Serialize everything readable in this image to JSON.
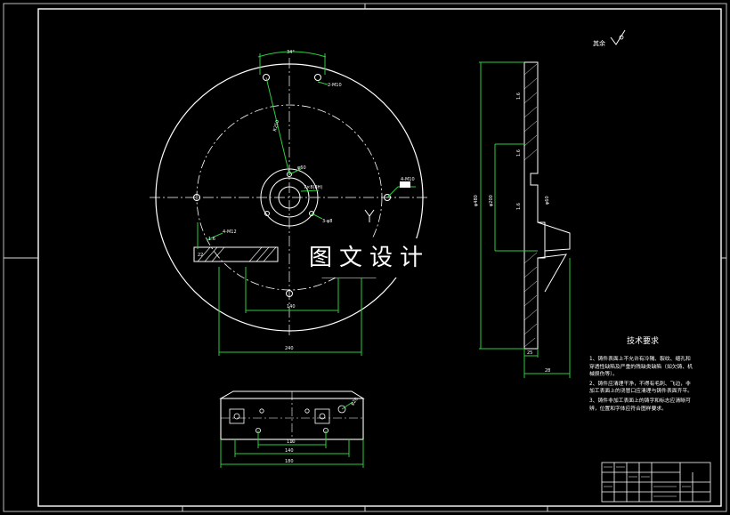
{
  "drawing": {
    "roughness_note": "其余",
    "watermark": "图文设计",
    "tech_requirements": {
      "title": "技术要求",
      "items": [
        "1、铸件表面上不允许有冷隔、裂纹、缩孔和穿透性缺陷及严重的残缺类缺陷（如欠铸、机械损伤等）。",
        "2、铸件应清理干净，不得有毛刺、飞边，非加工表面上的浇冒口应清理与铸件表面齐平。",
        "3、铸件非加工表面上的铸字和标志应清晰可辨，位置和字体应符合图样要求。"
      ]
    },
    "dims_front": {
      "angle": "34°",
      "holes_top": "2-M10",
      "radius": "R250",
      "center_dia": "φ60",
      "hub_label": "7×8(8H)",
      "side_holes": "4-M10",
      "bottom_holes": "3-φ8",
      "section_holes": "4-M12",
      "d1": "1.6",
      "d2": "22",
      "w1": "140",
      "w2": "240"
    },
    "dims_side": {
      "total": "φ480",
      "inner": "φ200",
      "small": "φ60",
      "t1": "1.6",
      "t2": "1.6",
      "t3": "1.6",
      "w_bottom": "25",
      "w_total": "28"
    },
    "dims_plan": {
      "a": "110",
      "b": "140",
      "c": "180",
      "hole": "φ20"
    }
  }
}
